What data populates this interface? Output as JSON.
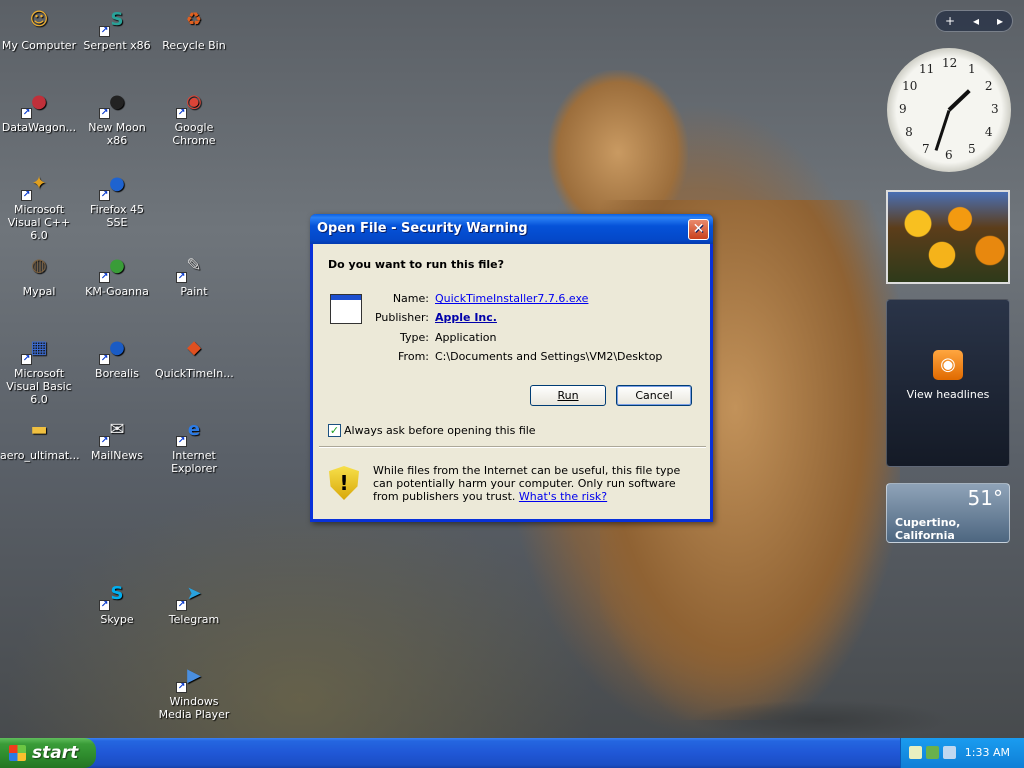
{
  "desktop": {
    "icons": [
      {
        "label": "My Computer",
        "glyph": "☺",
        "color": "#f0b030",
        "shortcut": false
      },
      {
        "label": "Serpent x86",
        "glyph": "S",
        "color": "#2aa198",
        "shortcut": true
      },
      {
        "label": "Recycle Bin",
        "glyph": "♻",
        "color": "#e06020",
        "shortcut": false
      },
      {
        "label": "DataWagon...",
        "glyph": "●",
        "color": "#c0303a",
        "shortcut": true
      },
      {
        "label": "New Moon x86",
        "glyph": "●",
        "color": "#222222",
        "shortcut": true
      },
      {
        "label": "Google Chrome",
        "glyph": "◉",
        "color": "#db4437",
        "shortcut": true
      },
      {
        "label": "Microsoft Visual C++ 6.0",
        "glyph": "✦",
        "color": "#e0a020",
        "shortcut": true
      },
      {
        "label": "Firefox 45 SSE",
        "glyph": "●",
        "color": "#1e63d0",
        "shortcut": true
      },
      {
        "label": "Mypal",
        "glyph": "◍",
        "color": "#7a6040",
        "shortcut": false
      },
      {
        "label": "KM-Goanna",
        "glyph": "●",
        "color": "#3a9c38",
        "shortcut": true
      },
      {
        "label": "Paint",
        "glyph": "✎",
        "color": "#d9d9d9",
        "shortcut": true
      },
      {
        "label": "Microsoft Visual Basic 6.0",
        "glyph": "▦",
        "color": "#3a6ad0",
        "shortcut": true
      },
      {
        "label": "Borealis",
        "glyph": "●",
        "color": "#1a5bc4",
        "shortcut": true
      },
      {
        "label": "QuickTimeIn...",
        "glyph": "◆",
        "color": "#e05020",
        "shortcut": false
      },
      {
        "label": "aero_ultimat...",
        "glyph": "▬",
        "color": "#f0c040",
        "shortcut": false
      },
      {
        "label": "MailNews",
        "glyph": "✉",
        "color": "#eeeeee",
        "shortcut": true
      },
      {
        "label": "Internet Explorer",
        "glyph": "e",
        "color": "#2c7be5",
        "shortcut": true
      },
      {
        "label": "Skype",
        "glyph": "S",
        "color": "#00aff0",
        "shortcut": true
      },
      {
        "label": "Telegram",
        "glyph": "➤",
        "color": "#2aa3df",
        "shortcut": true
      },
      {
        "label": "Windows Media Player",
        "glyph": "▶",
        "color": "#4a8fe0",
        "shortcut": true
      }
    ]
  },
  "gadgets": {
    "toolbar": {
      "add_label": "+",
      "prev_label": "◂",
      "next_label": "▸"
    },
    "clock": {
      "numbers": [
        "12",
        "1",
        "2",
        "3",
        "4",
        "5",
        "6",
        "7",
        "8",
        "9",
        "10",
        "11"
      ],
      "time": "1:33"
    },
    "feed": {
      "label": "View headlines",
      "icon": "rss-icon"
    },
    "weather": {
      "temperature": "51°",
      "city": "Cupertino, California"
    }
  },
  "dialog": {
    "title": "Open File - Security Warning",
    "close_glyph": "✕",
    "question": "Do you want to run this file?",
    "fields": {
      "name_label": "Name:",
      "name_value": "QuickTimeInstaller7.7.6.exe",
      "publisher_label": "Publisher:",
      "publisher_value": "Apple Inc.",
      "type_label": "Type:",
      "type_value": "Application",
      "from_label": "From:",
      "from_value": "C:\\Documents and Settings\\VM2\\Desktop"
    },
    "run_label": "Run",
    "cancel_label": "Cancel",
    "checkbox_label": "Always ask before opening this file",
    "checkbox_checked": true,
    "warning_text": "While files from the Internet can be useful, this file type can potentially harm your computer. Only run software from publishers you trust.",
    "risk_link": "What's the risk?"
  },
  "taskbar": {
    "start_label": "start",
    "time": "1:33 AM"
  },
  "colors": {
    "titlebar": "#0552d8",
    "taskbar": "#2057d6",
    "start": "#3a9c38",
    "tray": "#0f7fd6"
  }
}
